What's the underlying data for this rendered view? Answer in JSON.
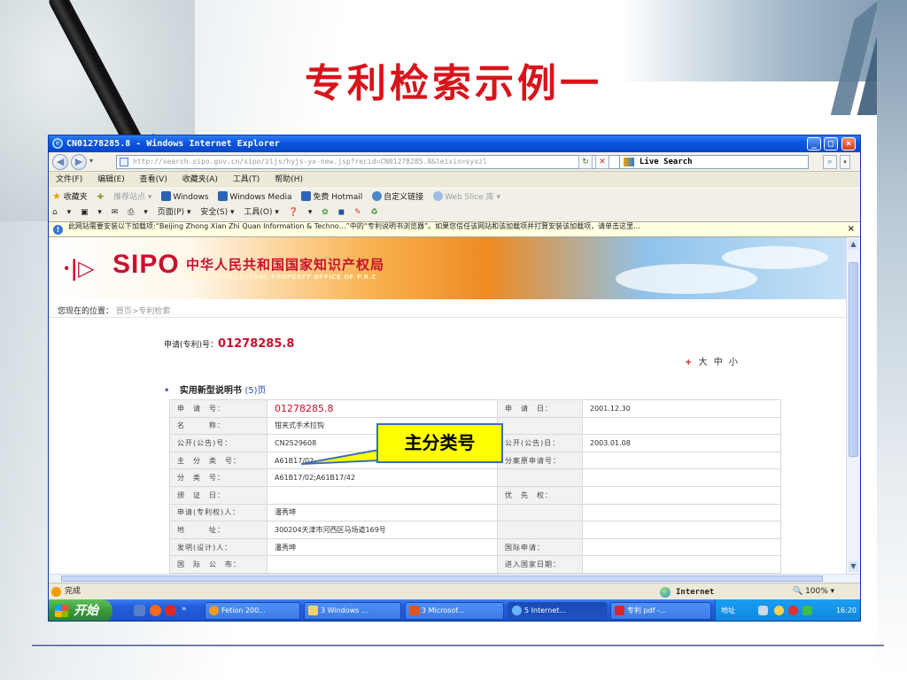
{
  "slide": {
    "title": "专利检索示例一"
  },
  "window": {
    "title": "CN01278285.8 - Windows Internet Explorer",
    "address": "http://search.sipo.gov.cn/sipo/zljs/hyjs-yx-new.jsp?recid=CN01278285.8&leixin=syxzl",
    "search_placeholder": "Live Search"
  },
  "menu": [
    "文件(F)",
    "编辑(E)",
    "查看(V)",
    "收藏夹(A)",
    "工具(T)",
    "帮助(H)"
  ],
  "favorites": {
    "label": "收藏夹",
    "items": [
      "推荐站点 ▾",
      "Windows",
      "Windows Media",
      "免费 Hotmail",
      "自定义链接",
      "Web Slice 库 ▾"
    ]
  },
  "command_bar": [
    "▾",
    "▾",
    "▾",
    "页面(P) ▾",
    "安全(S) ▾",
    "工具(O) ▾",
    "▾"
  ],
  "infobar": {
    "text": "此网站需要安装以下加载项:“Beijing Zhong Xian Zhi Quan Information & Techno…”中的“专利说明书浏览器”。如果您信任该网站和该加载项并打算安装该加载项，请单击这里..."
  },
  "page": {
    "banner": {
      "logo_text": "SIPO",
      "cn_name": "中华人民共和国国家知识产权局",
      "en_name": "STATE INTELLECTUAL PROPERTY OFFICE OF P.R.C"
    },
    "breadcrumb": {
      "label": "您现在的位置：",
      "path": "首页>专利检索"
    },
    "application_no": {
      "label": "申请(专利)号：",
      "value": "01278285.8"
    },
    "font_size": {
      "plus": "+",
      "options": "大 中 小"
    },
    "section": {
      "title": "实用新型说明书",
      "pages": "(5)页"
    },
    "fields": [
      {
        "l1": "申　请　号：",
        "v1": "01278285.8",
        "l2": "申　请　日：",
        "v2": "2001.12.30"
      },
      {
        "l1": "名　　　称：",
        "v1": "钳夹式手术拉钩",
        "l2": "",
        "v2": ""
      },
      {
        "l1": "公开(公告)号：",
        "v1": "CN2529608",
        "l2": "公开(公告)日：",
        "v2": "2003.01.08"
      },
      {
        "l1": "主　分　类　号：",
        "v1": "A61B17/02",
        "l2": "分案原申请号：",
        "v2": ""
      },
      {
        "l1": "分　类　号：",
        "v1": "A61B17/02;A61B17/42",
        "l2": "",
        "v2": ""
      },
      {
        "l1": "颁　证　日：",
        "v1": "",
        "l2": "优　先　权：",
        "v2": ""
      },
      {
        "l1": "申请(专利权)人：",
        "v1": "潘秀坤",
        "l2": "",
        "v2": ""
      },
      {
        "l1": "地　　　址：",
        "v1": "300204天津市河西区马场道169号",
        "l2": "",
        "v2": ""
      },
      {
        "l1": "发明(设计)人：",
        "v1": "潘秀坤",
        "l2": "国际申请：",
        "v2": ""
      },
      {
        "l1": "国　际　公　布：",
        "v1": "",
        "l2": "进入国家日期：",
        "v2": ""
      }
    ]
  },
  "status": {
    "text": "完成",
    "zone": "Internet",
    "zoom": "100%"
  },
  "taskbar": {
    "start": "开始",
    "tasks": [
      "Fetion 200...",
      "3 Windows ...",
      "3 Microsof...",
      "5 Internet...",
      "专利 pdf -..."
    ],
    "tray_label": "地址",
    "clock": "16:20"
  },
  "callout": {
    "text": "主分类号"
  }
}
